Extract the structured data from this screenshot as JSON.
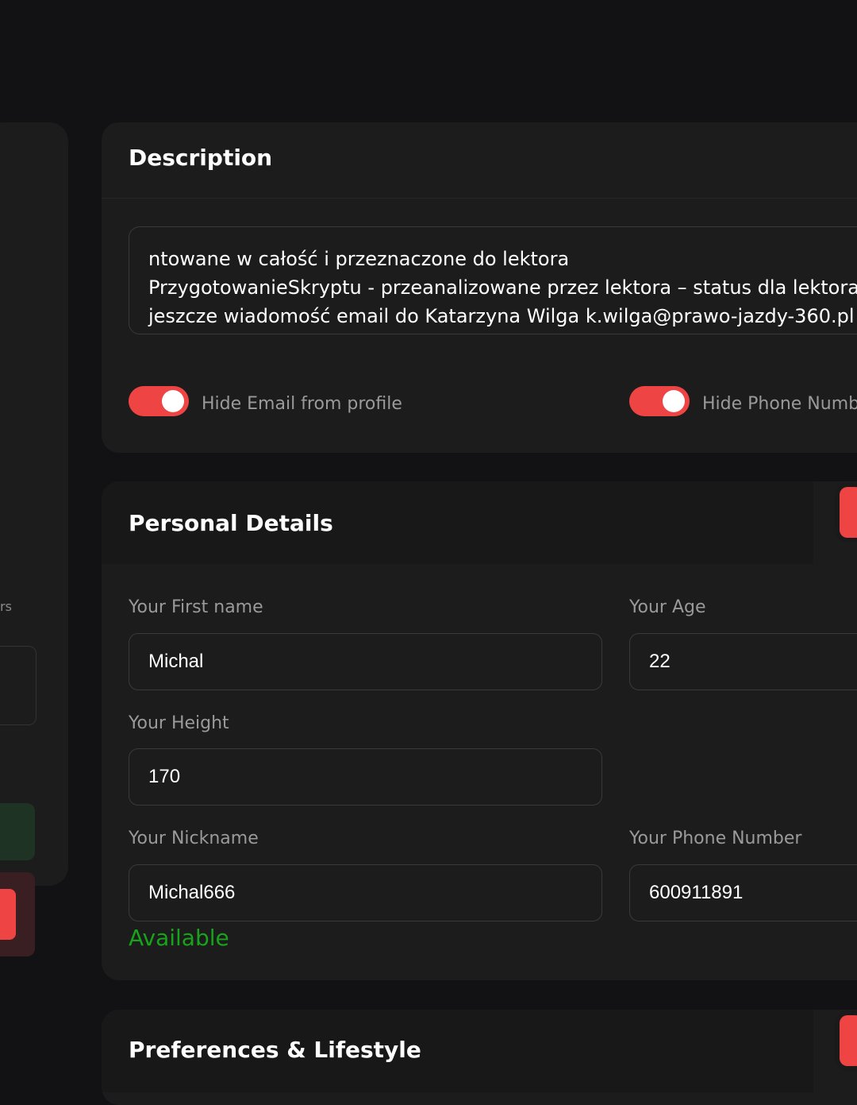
{
  "left_panel": {
    "partial_text": "rs"
  },
  "description": {
    "title": "Description",
    "text_lines": [
      "ntowane w całość i przeznaczone do lektora",
      "PrzygotowanieSkryptu - przeanalizowane przez lektora – status dla lektora,",
      "jeszcze wiadomość email do Katarzyna Wilga k.wilga@prawo-jazdy-360.pl"
    ],
    "toggles": [
      {
        "label": "Hide Email from profile",
        "on": true
      },
      {
        "label": "Hide Phone Numb",
        "on": true
      }
    ]
  },
  "personal": {
    "title": "Personal Details",
    "first_name_label": "Your First name",
    "first_name_value": "Michal",
    "age_label": "Your Age",
    "age_value": "22",
    "height_label": "Your Height",
    "height_value": "170",
    "nickname_label": "Your Nickname",
    "nickname_value": "Michal666",
    "nickname_status": "Available",
    "phone_label": "Your Phone Number",
    "phone_value": "600911891"
  },
  "preferences": {
    "title": "Preferences & Lifestyle"
  },
  "colors": {
    "accent": "#ef4444",
    "success": "#17a31a",
    "card": "#1c1c1c",
    "background": "#121214"
  }
}
